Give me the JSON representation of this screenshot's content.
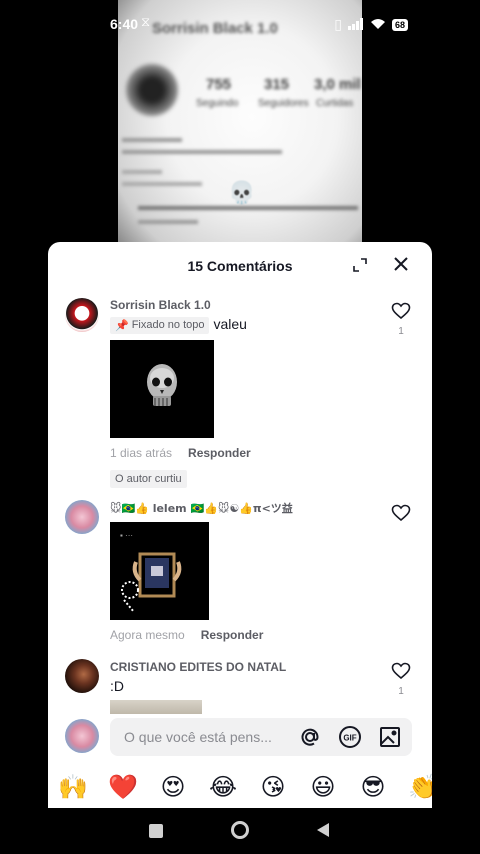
{
  "status_bar": {
    "time": "6:40",
    "notif_icon": "sync-notification-icon",
    "battery": "68"
  },
  "video_bg": {
    "profile_name": "Sorrisin Black 1.0",
    "stats": [
      {
        "value": "755",
        "label": "Seguindo"
      },
      {
        "value": "315",
        "label": "Seguidores"
      },
      {
        "value": "3,0 mil",
        "label": "Curtidas"
      }
    ]
  },
  "sheet": {
    "title": "15 Comentários",
    "comments": [
      {
        "author": "Sorrisin Black 1.0",
        "pinned_label": "Fixado no topo",
        "text": "valeu",
        "time": "1 dias atrás",
        "reply": "Responder",
        "author_liked": "O autor curtiu",
        "likes": "1"
      },
      {
        "author": "🐭🇧🇷👍 lelem 🇧🇷👍🐭☯👍π<ツ益",
        "time": "Agora mesmo",
        "reply": "Responder"
      },
      {
        "author": "CRISTIANO EDITES  DO NATAL",
        "text": ":D",
        "likes": "1"
      }
    ],
    "input_placeholder": "O que você está pens...",
    "emojis": [
      "🙌",
      "❤️",
      "😍",
      "😂",
      "😘",
      "😃",
      "😎",
      "👏"
    ]
  },
  "colors": {
    "accent_heart": "#161823",
    "sheet_bg": "#ffffff",
    "input_bg": "#f1f1f2"
  }
}
